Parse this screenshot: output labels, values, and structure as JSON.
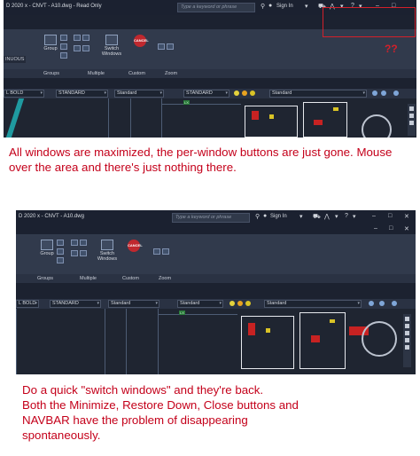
{
  "screenshot1": {
    "title": "D 2020  x - CNVT - A10.dwg - Read Only",
    "search_placeholder": "Type a keyword or phrase",
    "sign_in": "Sign In",
    "ribbon": {
      "group_button": "Group",
      "switch_windows": "Switch\nWindows",
      "stop_label": "CANCEL",
      "left_label": "INUOUS",
      "panels": [
        "Groups",
        "Multiple",
        "Custom",
        "Zoom"
      ]
    },
    "properties": {
      "layer": "L BOLD",
      "textstyle": "STANDARD",
      "dimstyle": "Standard",
      "tablestyle": "STANDARD",
      "multileader": "Standard"
    },
    "annotation": "??"
  },
  "screenshot2": {
    "title": "D 2020  x - CNVT - A10.dwg",
    "search_placeholder": "Type a keyword or phrase",
    "sign_in": "Sign In",
    "ribbon": {
      "group_button": "Group",
      "switch_windows": "Switch\nWindows",
      "stop_label": "CANCEL",
      "panels": [
        "Groups",
        "Multiple",
        "Custom",
        "Zoom"
      ]
    },
    "properties": {
      "layer": "L BOLD",
      "textstyle": "STANDARD",
      "dimstyle": "Standard",
      "tablestyle": "Standard",
      "multileader": "Standard"
    },
    "window_controls": [
      "–",
      "□",
      "✕"
    ]
  },
  "captions": {
    "first": "All windows are maximized, the per-window buttons are just gone. Mouse over the area and there's just nothing there.",
    "second_lines": [
      "Do a quick \"switch windows\" and they're back.",
      "Both the Minimize, Restore Down, Close buttons and",
      "NAVBAR have the problem of disappearing",
      "spontaneously."
    ]
  },
  "colors": {
    "caption": "#c4001a",
    "annotation_box": "#d3202a",
    "ui_background": "#1c2230"
  }
}
